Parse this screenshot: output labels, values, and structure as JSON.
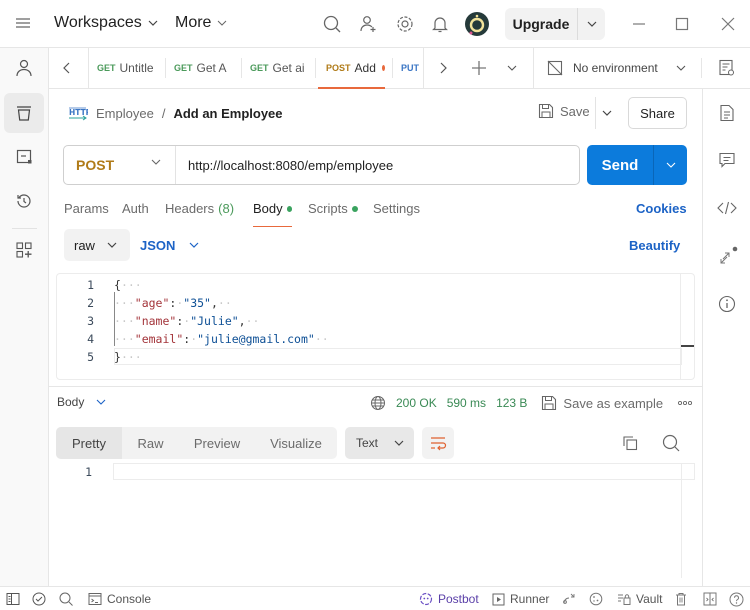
{
  "titlebar": {
    "workspaces": "Workspaces",
    "more": "More",
    "upgrade": "Upgrade",
    "icons": [
      "hamburger-icon",
      "search-icon",
      "invite-user-icon",
      "settings-icon",
      "notifications-icon",
      "avatar",
      "minimize-icon",
      "maximize-icon",
      "close-icon"
    ]
  },
  "tabs": [
    {
      "method": "GET",
      "name": "Untitle"
    },
    {
      "method": "GET",
      "name": "Get A"
    },
    {
      "method": "GET",
      "name": "Get ai"
    },
    {
      "method": "POST",
      "name": "Add",
      "active": true,
      "unsaved": true
    },
    {
      "method": "PUT",
      "name": ""
    }
  ],
  "environment": {
    "label": "No environment"
  },
  "breadcrumb": {
    "protocol": "HTTP",
    "parent": "Employee",
    "separator": "/",
    "current": "Add an Employee"
  },
  "actions": {
    "save": "Save",
    "share": "Share"
  },
  "request": {
    "method": "POST",
    "url": "http://localhost:8080/emp/employee",
    "send": "Send"
  },
  "request_tabs": [
    {
      "label": "Params"
    },
    {
      "label": "Auth"
    },
    {
      "label": "Headers",
      "count": "(8)"
    },
    {
      "label": "Body",
      "active": true,
      "dot": true
    },
    {
      "label": "Scripts",
      "dot": true
    },
    {
      "label": "Settings"
    }
  ],
  "cookies": "Cookies",
  "body_mode": {
    "type": "raw",
    "format": "JSON",
    "beautify": "Beautify"
  },
  "editor": {
    "lines": [
      {
        "no": "1"
      },
      {
        "no": "2",
        "key": "\"age\"",
        "value": "\"35\""
      },
      {
        "no": "3",
        "key": "\"name\"",
        "value": "\"Julie\""
      },
      {
        "no": "4",
        "key": "\"email\"",
        "value": "\"julie@gmail.com\""
      },
      {
        "no": "5"
      }
    ],
    "open_brace": "{",
    "close_brace": "}"
  },
  "response": {
    "section": "Body",
    "status": "200 OK",
    "time": "590 ms",
    "size": "123 B",
    "save_example": "Save as example",
    "view_tabs": [
      "Pretty",
      "Raw",
      "Preview",
      "Visualize"
    ],
    "format": "Text",
    "line_no": "1"
  },
  "statusbar": {
    "console": "Console",
    "postbot": "Postbot",
    "runner": "Runner",
    "vault": "Vault"
  },
  "colors": {
    "accent": "#e8693c",
    "send": "#0c7bdc",
    "post": "#b07b18",
    "get": "#4b9a5b",
    "put": "#3a75c4",
    "link": "#1c63c6",
    "ok": "#3a8a55"
  }
}
